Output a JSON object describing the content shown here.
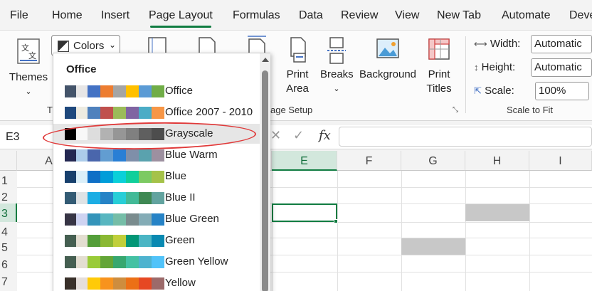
{
  "menu": {
    "tabs": [
      "File",
      "Home",
      "Insert",
      "Page Layout",
      "Formulas",
      "Data",
      "Review",
      "View",
      "New Tab",
      "Automate",
      "Deve"
    ],
    "active": "Page Layout"
  },
  "ribbon": {
    "themes_label": "Themes",
    "colors_label": "Colors",
    "themes_group_label": "T",
    "print_area_label": "Print Area",
    "breaks_label": "Breaks",
    "background_label": "Background",
    "print_titles_label": "Print Titles",
    "page_setup_label": "age Setup",
    "scale_to_fit_label": "Scale to Fit",
    "width_label": "Width:",
    "width_value": "Automatic",
    "height_label": "Height:",
    "height_value": "Automatic",
    "scale_label": "Scale:",
    "scale_value": "100%"
  },
  "formula_bar": {
    "name_box": "E3",
    "fx": "fx"
  },
  "sheet": {
    "columns": [
      "A",
      "E",
      "F",
      "G",
      "H",
      "I"
    ],
    "rows": [
      "1",
      "2",
      "3",
      "4",
      "5",
      "6",
      "7"
    ],
    "selected_column": "E",
    "selected_row": "3",
    "fill_color": "#c8c8c8"
  },
  "colors_dropdown": {
    "header": "Office",
    "items": [
      {
        "label": "Office",
        "colors": [
          "#44546a",
          "#e7e6e6",
          "#4472c4",
          "#ed7d31",
          "#a5a5a5",
          "#ffc000",
          "#5b9bd5",
          "#70ad47"
        ]
      },
      {
        "label": "Office 2007 - 2010",
        "colors": [
          "#1f497d",
          "#eeece1",
          "#4f81bd",
          "#c0504d",
          "#9bbb59",
          "#8064a2",
          "#4bacc6",
          "#f79646"
        ]
      },
      {
        "label": "Grayscale",
        "colors": [
          "#000000",
          "#f8f8f8",
          "#dddddd",
          "#b2b2b2",
          "#969696",
          "#808080",
          "#5f5f5f",
          "#4d4d4d"
        ]
      },
      {
        "label": "Blue Warm",
        "colors": [
          "#242852",
          "#acccea",
          "#4a66ac",
          "#629dd1",
          "#297fd5",
          "#7f8fa9",
          "#5aa2ae",
          "#9d90a0"
        ]
      },
      {
        "label": "Blue",
        "colors": [
          "#17406d",
          "#dbeff9",
          "#0f6fc6",
          "#009dd9",
          "#0bd0d9",
          "#10cf9b",
          "#7cca62",
          "#a5c249"
        ]
      },
      {
        "label": "Blue II",
        "colors": [
          "#335b74",
          "#dfe3e5",
          "#1cade4",
          "#2683c6",
          "#27ced7",
          "#42ba97",
          "#3e8853",
          "#62a39f"
        ]
      },
      {
        "label": "Blue Green",
        "colors": [
          "#373545",
          "#ced3f1",
          "#3494ba",
          "#58b6c0",
          "#75bda7",
          "#7a8c8e",
          "#84acb6",
          "#2683c6"
        ]
      },
      {
        "label": "Green",
        "colors": [
          "#455f51",
          "#e3ded1",
          "#549e39",
          "#8ab833",
          "#c0cf3a",
          "#029676",
          "#4ab5c4",
          "#0989b1"
        ]
      },
      {
        "label": "Green Yellow",
        "colors": [
          "#455f51",
          "#e3ded1",
          "#99cb38",
          "#63a537",
          "#37a76f",
          "#44c1a3",
          "#4eb3cf",
          "#51c3f9"
        ]
      },
      {
        "label": "Yellow",
        "colors": [
          "#39302a",
          "#e5dedb",
          "#ffca08",
          "#f8931d",
          "#ce8d3e",
          "#ec7016",
          "#e64823",
          "#9c6a6a"
        ]
      }
    ],
    "hovered": "Grayscale"
  },
  "colors": {
    "accent": "#107c41",
    "annotation": "#e03a3a"
  }
}
